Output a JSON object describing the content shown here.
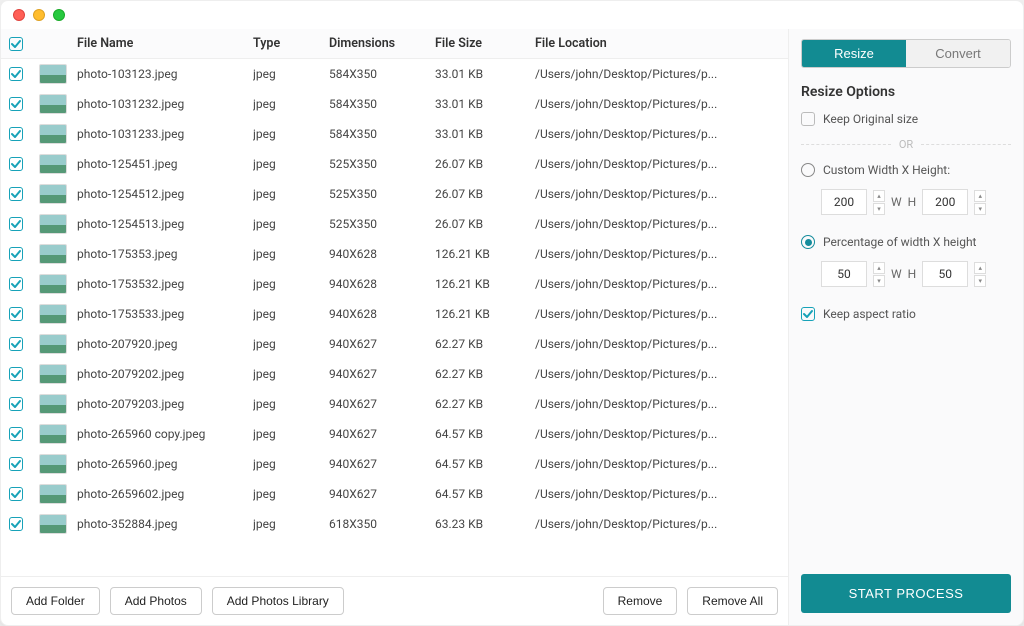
{
  "columns": {
    "file_name": "File Name",
    "type": "Type",
    "dimensions": "Dimensions",
    "file_size": "File Size",
    "file_location": "File Location"
  },
  "rows": [
    {
      "name": "photo-103123.jpeg",
      "type": "jpeg",
      "dim": "584X350",
      "size": "33.01 KB",
      "loc": "/Users/john/Desktop/Pictures/p..."
    },
    {
      "name": "photo-1031232.jpeg",
      "type": "jpeg",
      "dim": "584X350",
      "size": "33.01 KB",
      "loc": "/Users/john/Desktop/Pictures/p..."
    },
    {
      "name": "photo-1031233.jpeg",
      "type": "jpeg",
      "dim": "584X350",
      "size": "33.01 KB",
      "loc": "/Users/john/Desktop/Pictures/p..."
    },
    {
      "name": "photo-125451.jpeg",
      "type": "jpeg",
      "dim": "525X350",
      "size": "26.07 KB",
      "loc": "/Users/john/Desktop/Pictures/p..."
    },
    {
      "name": "photo-1254512.jpeg",
      "type": "jpeg",
      "dim": "525X350",
      "size": "26.07 KB",
      "loc": "/Users/john/Desktop/Pictures/p..."
    },
    {
      "name": "photo-1254513.jpeg",
      "type": "jpeg",
      "dim": "525X350",
      "size": "26.07 KB",
      "loc": "/Users/john/Desktop/Pictures/p..."
    },
    {
      "name": "photo-175353.jpeg",
      "type": "jpeg",
      "dim": "940X628",
      "size": "126.21 KB",
      "loc": "/Users/john/Desktop/Pictures/p..."
    },
    {
      "name": "photo-1753532.jpeg",
      "type": "jpeg",
      "dim": "940X628",
      "size": "126.21 KB",
      "loc": "/Users/john/Desktop/Pictures/p..."
    },
    {
      "name": "photo-1753533.jpeg",
      "type": "jpeg",
      "dim": "940X628",
      "size": "126.21 KB",
      "loc": "/Users/john/Desktop/Pictures/p..."
    },
    {
      "name": "photo-207920.jpeg",
      "type": "jpeg",
      "dim": "940X627",
      "size": "62.27 KB",
      "loc": "/Users/john/Desktop/Pictures/p..."
    },
    {
      "name": "photo-2079202.jpeg",
      "type": "jpeg",
      "dim": "940X627",
      "size": "62.27 KB",
      "loc": "/Users/john/Desktop/Pictures/p..."
    },
    {
      "name": "photo-2079203.jpeg",
      "type": "jpeg",
      "dim": "940X627",
      "size": "62.27 KB",
      "loc": "/Users/john/Desktop/Pictures/p..."
    },
    {
      "name": "photo-265960 copy.jpeg",
      "type": "jpeg",
      "dim": "940X627",
      "size": "64.57 KB",
      "loc": "/Users/john/Desktop/Pictures/p..."
    },
    {
      "name": "photo-265960.jpeg",
      "type": "jpeg",
      "dim": "940X627",
      "size": "64.57 KB",
      "loc": "/Users/john/Desktop/Pictures/p..."
    },
    {
      "name": "photo-2659602.jpeg",
      "type": "jpeg",
      "dim": "940X627",
      "size": "64.57 KB",
      "loc": "/Users/john/Desktop/Pictures/p..."
    },
    {
      "name": "photo-352884.jpeg",
      "type": "jpeg",
      "dim": "618X350",
      "size": "63.23 KB",
      "loc": "/Users/john/Desktop/Pictures/p..."
    }
  ],
  "toolbar": {
    "add_folder": "Add Folder",
    "add_photos": "Add Photos",
    "add_library": "Add Photos Library",
    "remove": "Remove",
    "remove_all": "Remove All"
  },
  "panel": {
    "tab_resize": "Resize",
    "tab_convert": "Convert",
    "resize_options": "Resize Options",
    "keep_original": "Keep Original size",
    "or_label": "OR",
    "custom_label": "Custom Width X Height:",
    "percent_label": "Percentage of width X height",
    "aspect_ratio": "Keep aspect ratio",
    "w_label": "W",
    "h_label": "H",
    "custom_w": "200",
    "custom_h": "200",
    "percent_w": "50",
    "percent_h": "50",
    "start": "START PROCESS"
  }
}
